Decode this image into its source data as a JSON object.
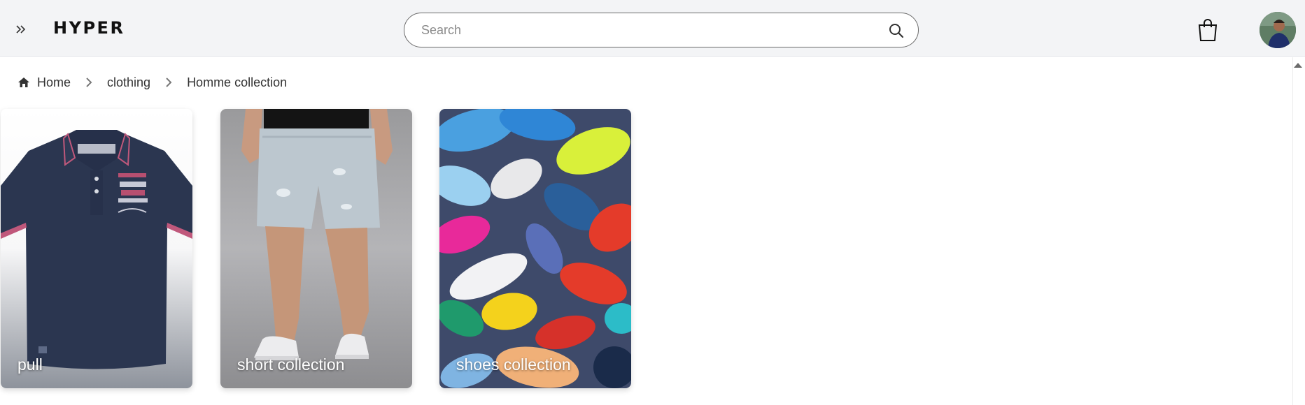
{
  "header": {
    "brand": "HYPER",
    "search": {
      "placeholder": "Search",
      "value": ""
    }
  },
  "breadcrumb": {
    "items": [
      {
        "label": "Home",
        "icon": "home-icon"
      },
      {
        "label": "clothing"
      },
      {
        "label": "Homme collection"
      }
    ]
  },
  "categories": [
    {
      "label": "pull",
      "image": "navy polo shirt"
    },
    {
      "label": "short collection",
      "image": "denim shorts"
    },
    {
      "label": "shoes collection",
      "image": "pile of running shoes"
    }
  ],
  "colors": {
    "header_bg": "#f3f4f6",
    "polo_navy": "#2b3650"
  }
}
